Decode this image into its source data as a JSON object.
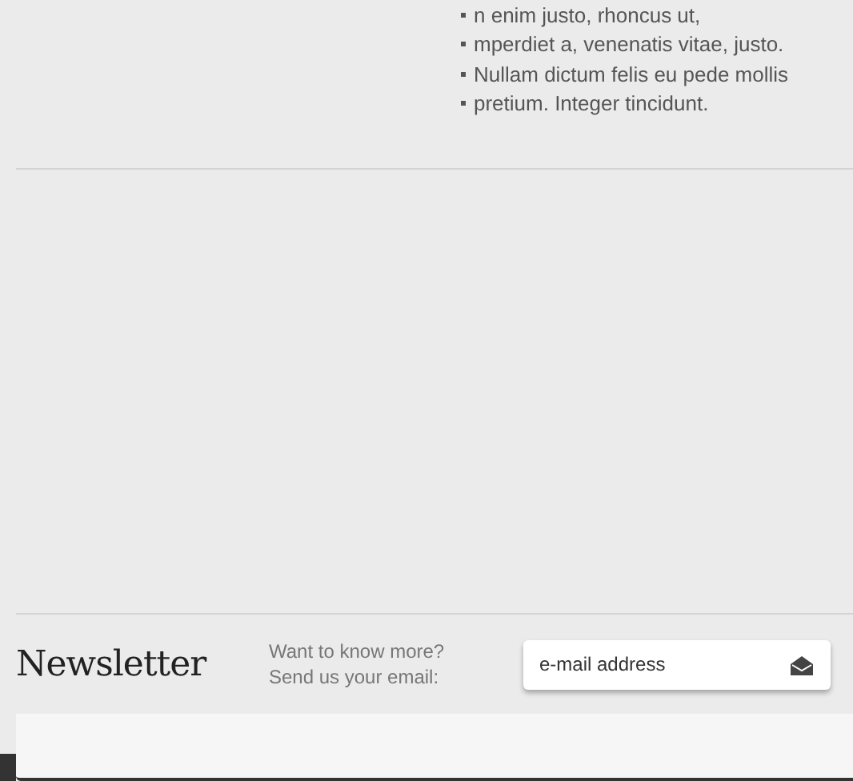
{
  "list_items": [
    "n enim justo, rhoncus ut,",
    "mperdiet a, venenatis vitae, justo.",
    "Nullam dictum felis eu pede mollis",
    "pretium. Integer tincidunt."
  ],
  "newsletter": {
    "title": "Newsletter",
    "prompt_lines": [
      "Want to know more?",
      "Send us your email:"
    ],
    "email_field": {
      "placeholder": "e-mail address"
    }
  }
}
